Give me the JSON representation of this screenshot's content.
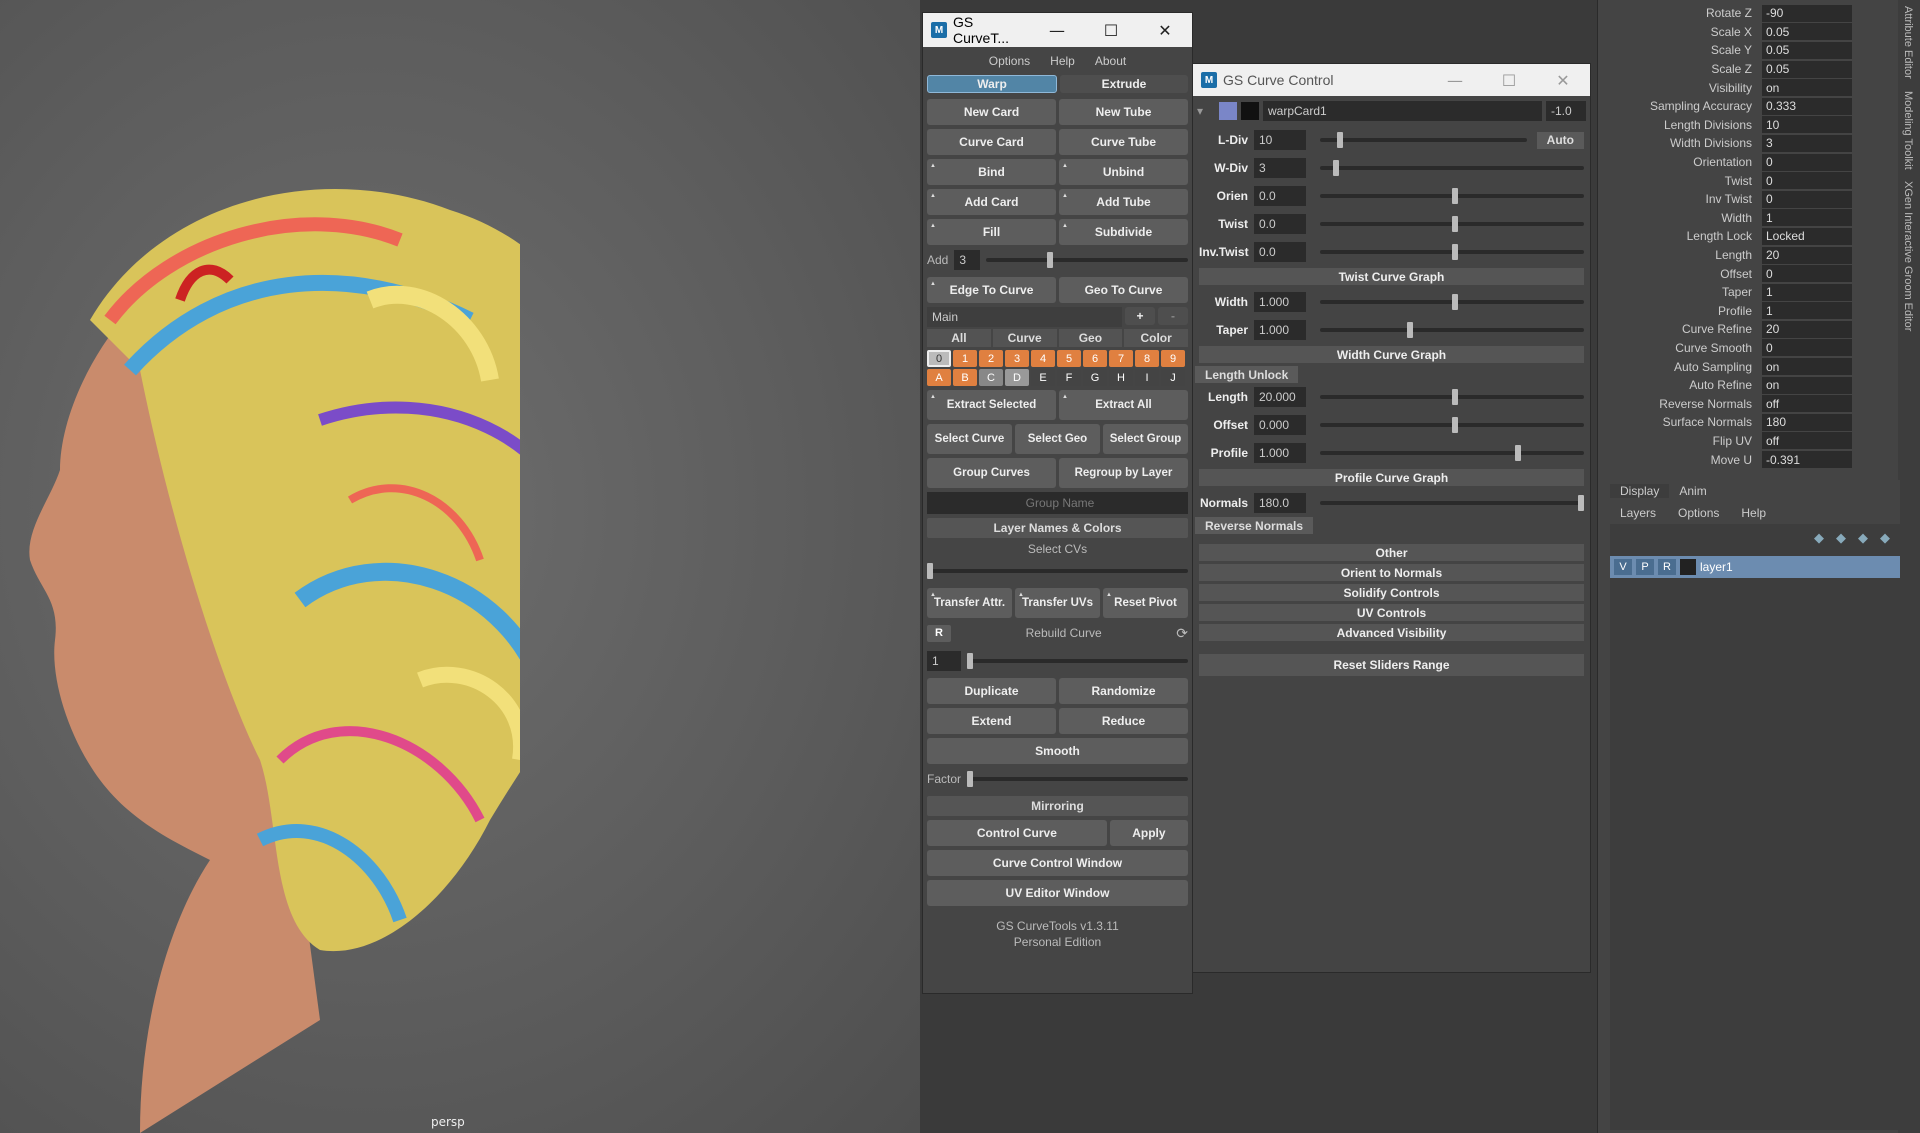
{
  "viewport": {
    "label": "persp"
  },
  "curvetools": {
    "title": "GS CurveT...",
    "menu": [
      "Options",
      "Help",
      "About"
    ],
    "warp": "Warp",
    "extrude": "Extrude",
    "new_card": "New Card",
    "new_tube": "New Tube",
    "curve_card": "Curve Card",
    "curve_tube": "Curve Tube",
    "bind": "Bind",
    "unbind": "Unbind",
    "add_card": "Add Card",
    "add_tube": "Add Tube",
    "fill": "Fill",
    "subdivide": "Subdivide",
    "add_label": "Add",
    "add_value": "3",
    "edge_to_curve": "Edge To Curve",
    "geo_to_curve": "Geo To Curve",
    "layer_collection": "Main",
    "plus": "+",
    "minus": "-",
    "filter_tabs": [
      "All",
      "Curve",
      "Geo",
      "Color"
    ],
    "layers_num": [
      "0",
      "1",
      "2",
      "3",
      "4",
      "5",
      "6",
      "7",
      "8",
      "9"
    ],
    "layers_alpha": [
      "A",
      "B",
      "C",
      "D",
      "E",
      "F",
      "G",
      "H",
      "I",
      "J"
    ],
    "extract_selected": "Extract Selected",
    "extract_all": "Extract All",
    "select_curve": "Select Curve",
    "select_geo": "Select Geo",
    "select_group": "Select Group",
    "group_curves": "Group Curves",
    "regroup_by_layer": "Regroup by Layer",
    "group_name_placeholder": "Group Name",
    "layer_names_colors": "Layer Names & Colors",
    "select_cvs": "Select CVs",
    "transfer_attr": "Transfer Attr.",
    "transfer_uvs": "Transfer UVs",
    "reset_pivot": "Reset Pivot",
    "r_label": "R",
    "rebuild_curve": "Rebuild Curve",
    "rebuild_value": "1",
    "duplicate": "Duplicate",
    "randomize": "Randomize",
    "extend": "Extend",
    "reduce": "Reduce",
    "smooth": "Smooth",
    "factor": "Factor",
    "mirroring": "Mirroring",
    "control_curve": "Control Curve",
    "apply": "Apply",
    "curve_control_window": "Curve Control Window",
    "uv_editor_window": "UV Editor Window",
    "version": "GS CurveTools v1.3.11",
    "edition": "Personal Edition"
  },
  "control": {
    "title": "GS Curve Control",
    "object_name": "warpCard1",
    "top_value": "-1.0",
    "auto": "Auto",
    "rows_a": [
      {
        "label": "L-Div",
        "value": "10",
        "pos": 0.08
      },
      {
        "label": "W-Div",
        "value": "3",
        "pos": 0.05
      },
      {
        "label": "Orien",
        "value": "0.0",
        "pos": 0.5
      },
      {
        "label": "Twist",
        "value": "0.0",
        "pos": 0.5
      },
      {
        "label": "Inv.Twist",
        "value": "0.0",
        "pos": 0.5
      }
    ],
    "twist_graph": "Twist Curve Graph",
    "rows_b": [
      {
        "label": "Width",
        "value": "1.000",
        "pos": 0.5
      },
      {
        "label": "Taper",
        "value": "1.000",
        "pos": 0.33
      }
    ],
    "width_graph": "Width Curve Graph",
    "length_unlock": "Length Unlock",
    "rows_c": [
      {
        "label": "Length",
        "value": "20.000",
        "pos": 0.5
      },
      {
        "label": "Offset",
        "value": "0.000",
        "pos": 0.5
      },
      {
        "label": "Profile",
        "value": "1.000",
        "pos": 0.74
      }
    ],
    "profile_graph": "Profile Curve Graph",
    "normals_label": "Normals",
    "normals_value": "180.0",
    "reverse_normals": "Reverse Normals",
    "sections": [
      "Other",
      "Orient to Normals",
      "Solidify Controls",
      "UV Controls",
      "Advanced Visibility"
    ],
    "reset_sliders": "Reset Sliders Range"
  },
  "attr": {
    "rows": [
      {
        "k": "Rotate Z",
        "v": "-90"
      },
      {
        "k": "Scale X",
        "v": "0.05"
      },
      {
        "k": "Scale Y",
        "v": "0.05"
      },
      {
        "k": "Scale Z",
        "v": "0.05"
      },
      {
        "k": "Visibility",
        "v": "on"
      },
      {
        "k": "Sampling Accuracy",
        "v": "0.333"
      },
      {
        "k": "Length Divisions",
        "v": "10"
      },
      {
        "k": "Width Divisions",
        "v": "3"
      },
      {
        "k": "Orientation",
        "v": "0"
      },
      {
        "k": "Twist",
        "v": "0"
      },
      {
        "k": "Inv Twist",
        "v": "0"
      },
      {
        "k": "Width",
        "v": "1"
      },
      {
        "k": "Length Lock",
        "v": "Locked"
      },
      {
        "k": "Length",
        "v": "20"
      },
      {
        "k": "Offset",
        "v": "0"
      },
      {
        "k": "Taper",
        "v": "1"
      },
      {
        "k": "Profile",
        "v": "1"
      },
      {
        "k": "Curve Refine",
        "v": "20"
      },
      {
        "k": "Curve Smooth",
        "v": "0"
      },
      {
        "k": "Auto Sampling",
        "v": "on"
      },
      {
        "k": "Auto Refine",
        "v": "on"
      },
      {
        "k": "Reverse Normals",
        "v": "off"
      },
      {
        "k": "Surface Normals",
        "v": "180"
      },
      {
        "k": "Flip UV",
        "v": "off"
      },
      {
        "k": "Move U",
        "v": "-0.391"
      }
    ],
    "side_tabs": [
      "Attribute Editor",
      "Modeling Toolkit",
      "XGen Interactive Groom Editor"
    ],
    "layer_tabs": [
      "Display",
      "Anim"
    ],
    "layer_menu": [
      "Layers",
      "Options",
      "Help"
    ],
    "layer_flags": [
      "V",
      "P",
      "R"
    ],
    "layer_name": "layer1"
  }
}
